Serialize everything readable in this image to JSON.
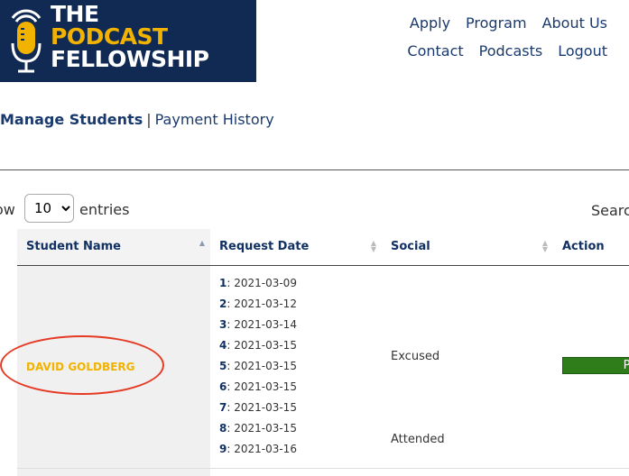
{
  "logo": {
    "line1": "THE",
    "line2": "PODCAST",
    "line3": "FELLOWSHIP",
    "icon": "microphone-icon",
    "colors": {
      "background": "#102a54",
      "accent": "#f2b300"
    }
  },
  "nav": {
    "row1": [
      "Apply",
      "Program",
      "About Us"
    ],
    "row2": [
      "Contact",
      "Podcasts",
      "Logout"
    ]
  },
  "subnav": {
    "active": "Manage Students",
    "separator": "|",
    "link": "Payment History"
  },
  "table_controls": {
    "show_label": "ow",
    "page_size": "10",
    "page_size_options": [
      "10"
    ],
    "entries_label": "entries",
    "search_label": "Searc"
  },
  "table": {
    "headers": [
      "Student Name",
      "Request Date",
      "Social",
      "Action"
    ],
    "rows": [
      {
        "student": "DAVID GOLDBERG",
        "dates": [
          {
            "n": "1",
            "d": ": 2021-03-09"
          },
          {
            "n": "2",
            "d": ": 2021-03-12"
          },
          {
            "n": "3",
            "d": ": 2021-03-14"
          },
          {
            "n": "4",
            "d": ": 2021-03-15"
          },
          {
            "n": "5",
            "d": ": 2021-03-15"
          },
          {
            "n": "6",
            "d": ": 2021-03-15"
          },
          {
            "n": "7",
            "d": ": 2021-03-15"
          },
          {
            "n": "8",
            "d": ": 2021-03-15"
          },
          {
            "n": "9",
            "d": ": 2021-03-16"
          }
        ],
        "social": [
          "Excused",
          "Attended"
        ],
        "action_label": "Po"
      }
    ]
  },
  "colors": {
    "action_button": "#2e7d1a",
    "highlight_circle": "#e53a24",
    "student_name": "#f2b300"
  }
}
